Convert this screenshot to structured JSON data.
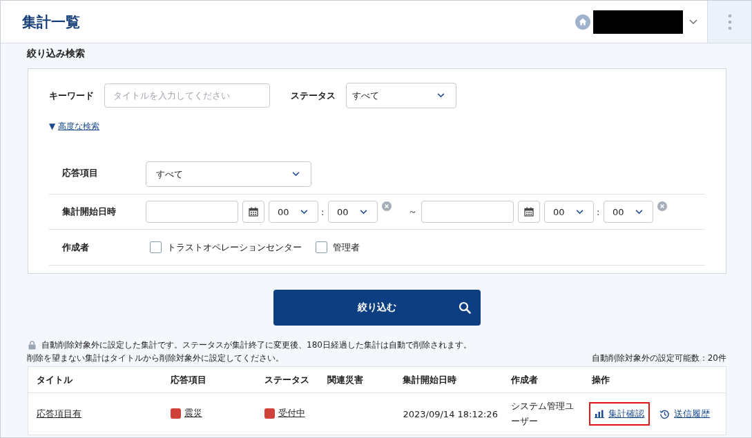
{
  "header": {
    "title": "集計一覧"
  },
  "filter": {
    "heading": "絞り込み検索",
    "keyword": {
      "label": "キーワード",
      "placeholder": "タイトルを入力してください"
    },
    "status": {
      "label": "ステータス",
      "value": "すべて"
    },
    "advanced_toggle": {
      "marker": "▼",
      "label": "高度な検索"
    },
    "response_item": {
      "label": "応答項目",
      "value": "すべて"
    },
    "start_datetime": {
      "label": "集計開始日時",
      "colon": ":",
      "separator": "～",
      "from": {
        "hour": "00",
        "minute": "00"
      },
      "to": {
        "hour": "00",
        "minute": "00"
      }
    },
    "creator": {
      "label": "作成者",
      "options": [
        {
          "label": "トラストオペレーションセンター",
          "checked": false
        },
        {
          "label": "管理者",
          "checked": false
        }
      ]
    },
    "submit": "絞り込む"
  },
  "notice": {
    "lines": [
      "自動削除対象外に設定した集計です。ステータスが集計終了に変更後、180日経過した集計は自動で削除されます。",
      "削除を望まない集計はタイトルから削除対象外に設定してください。"
    ],
    "quota": "自動削除対象外の設定可能数：20件"
  },
  "table": {
    "columns": [
      "タイトル",
      "応答項目",
      "ステータス",
      "関連災害",
      "集計開始日時",
      "作成者",
      "操作"
    ],
    "rows": [
      {
        "title": "応答項目有",
        "response_item": {
          "label": "震災",
          "color": "#d0413a"
        },
        "status": {
          "label": "受付中",
          "color": "#d0413a"
        },
        "start": "2023/09/14 18:12:26",
        "creator": "システム管理ユーザー",
        "actions": [
          {
            "kind": "chart",
            "label": "集計確認",
            "highlighted": true
          },
          {
            "kind": "history",
            "label": "送信履歴",
            "highlighted": false
          }
        ]
      }
    ]
  }
}
